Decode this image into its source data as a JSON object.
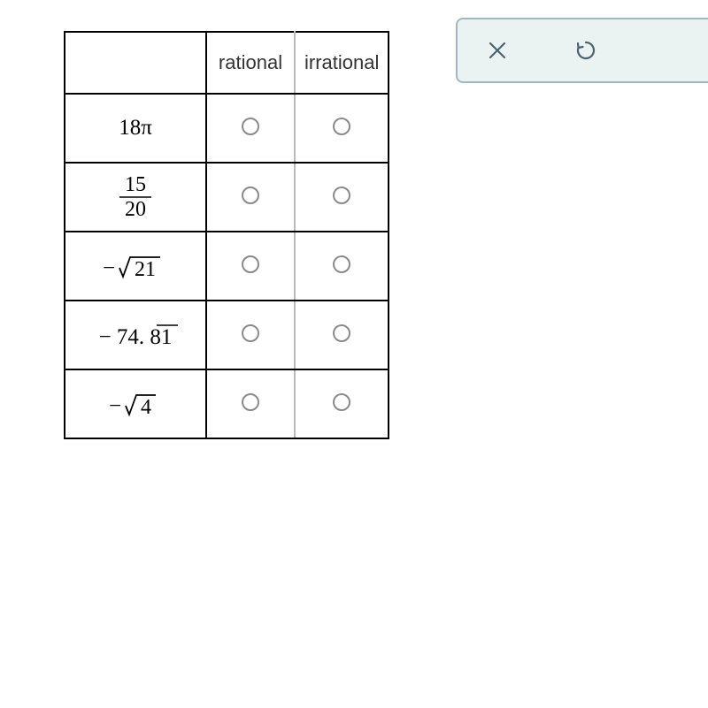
{
  "table": {
    "headers": [
      "",
      "rational",
      "irrational"
    ],
    "rows": [
      {
        "expression": "18π",
        "rational_selected": false,
        "irrational_selected": false
      },
      {
        "expression": "15/20",
        "rational_selected": false,
        "irrational_selected": false
      },
      {
        "expression": "-√21",
        "rational_selected": false,
        "irrational_selected": false
      },
      {
        "expression": "-74.81̅",
        "rational_selected": false,
        "irrational_selected": false
      },
      {
        "expression": "-√4",
        "rational_selected": false,
        "irrational_selected": false
      }
    ]
  },
  "toolbar": {
    "close_label": "close",
    "undo_label": "undo"
  }
}
